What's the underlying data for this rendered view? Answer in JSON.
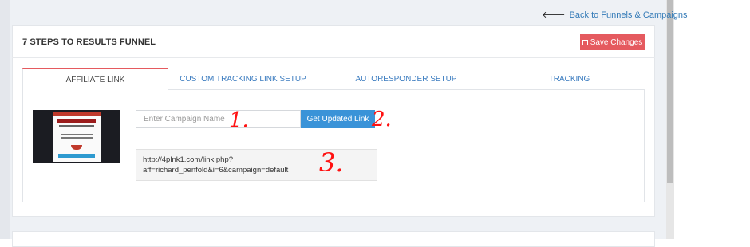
{
  "header": {
    "back_link": "Back to Funnels & Campaigns",
    "title": "7 STEPS TO RESULTS FUNNEL",
    "save_button": "Save Changes"
  },
  "tabs": [
    {
      "label": "AFFILIATE LINK",
      "active": true
    },
    {
      "label": "CUSTOM TRACKING LINK SETUP",
      "active": false
    },
    {
      "label": "AUTORESPONDER SETUP",
      "active": false
    },
    {
      "label": "TRACKING",
      "active": false
    }
  ],
  "affiliate": {
    "campaign_placeholder": "Enter Campaign Name",
    "campaign_value": "",
    "get_link_button": "Get Updated Link",
    "link_line1": "http://4plnk1.com/link.php?",
    "link_line2": "aff=richard_penfold&i=6&campaign=default"
  },
  "annotations": [
    "1.",
    "2.",
    "3."
  ],
  "colors": {
    "accent": "#e55a5f",
    "link": "#3a7bbf",
    "primary_button": "#3a93d8",
    "annotation": "#ff1111"
  }
}
